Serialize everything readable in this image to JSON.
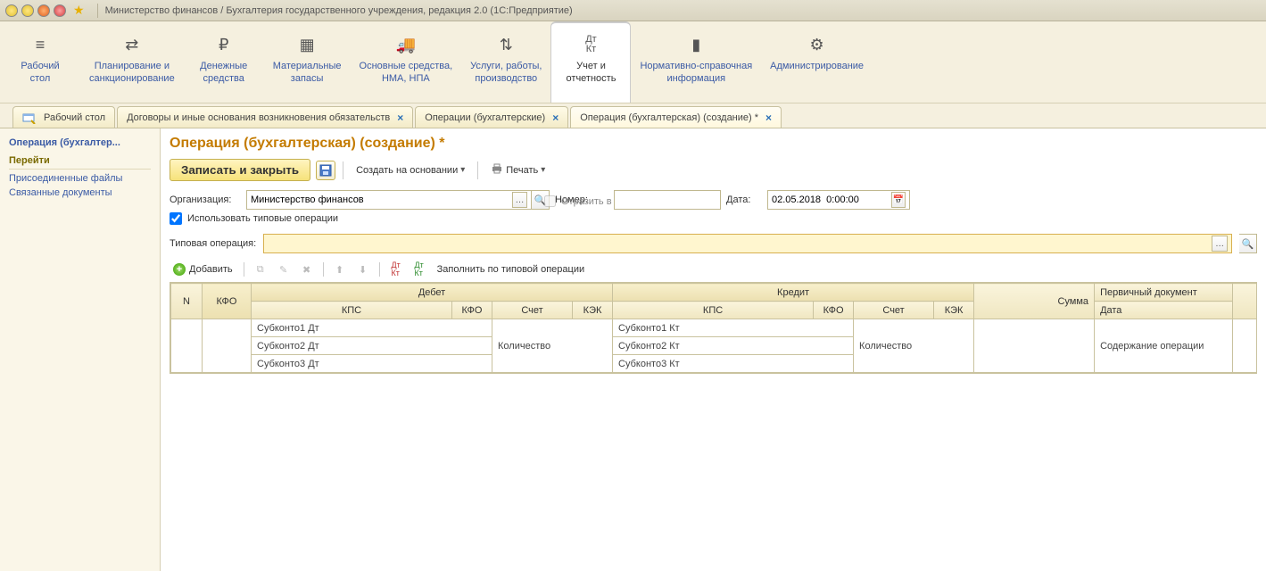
{
  "window": {
    "title": "Министерство финансов / Бухгалтерия государственного учреждения, редакция 2.0  (1С:Предприятие)"
  },
  "mainnav": [
    {
      "label": "Рабочий\nстол"
    },
    {
      "label": "Планирование и\nсанкционирование"
    },
    {
      "label": "Денежные\nсредства"
    },
    {
      "label": "Материальные\nзапасы"
    },
    {
      "label": "Основные средства,\nНМА, НПА"
    },
    {
      "label": "Услуги, работы,\nпроизводство"
    },
    {
      "label": "Учет и\nотчетность"
    },
    {
      "label": "Нормативно-справочная\nинформация"
    },
    {
      "label": "Администрирование"
    }
  ],
  "tabs": [
    {
      "label": "Рабочий стол",
      "closable": false,
      "with_icon": true
    },
    {
      "label": "Договоры и иные основания возникновения обязательств",
      "closable": true
    },
    {
      "label": "Операции (бухгалтерские)",
      "closable": true
    },
    {
      "label": "Операция (бухгалтерская) (создание) *",
      "closable": true,
      "active": true
    }
  ],
  "sidebar": {
    "title": "Операция (бухгалтер...",
    "heading": "Перейти",
    "links": [
      "Присоединенные файлы",
      "Связанные документы"
    ]
  },
  "page": {
    "title": "Операция (бухгалтерская) (создание) *",
    "btn_write_close": "Записать и закрыть",
    "btn_create_based": "Создать на основании",
    "btn_print": "Печать",
    "label_org": "Организация:",
    "org_value": "Министерство финансов",
    "label_number": "Номер:",
    "number_value": "",
    "label_date": "Дата:",
    "date_value": "02.05.2018  0:00:00",
    "reflect": "Отразить в межотчетном периоде",
    "use_typed": "Использовать типовые операции",
    "label_typed": "Типовая операция:",
    "typed_value": ""
  },
  "grid_tb": {
    "add": "Добавить",
    "fill": "Заполнить по типовой операции"
  },
  "grid": {
    "n": "N",
    "kfo": "КФО",
    "debit": "Дебет",
    "credit": "Кредит",
    "sum": "Сумма",
    "primary_doc": "Первичный документ",
    "kps": "КПС",
    "kfo2": "КФО",
    "account": "Счет",
    "kek": "КЭК",
    "date": "Дата",
    "n2": "Н",
    "subk1d": "Субконто1 Дт",
    "subk2d": "Субконто2 Дт",
    "subk3d": "Субконто3 Дт",
    "subk1k": "Субконто1 Кт",
    "subk2k": "Субконто2 Кт",
    "subk3k": "Субконто3 Кт",
    "qty": "Количество",
    "op_content": "Содержание операции"
  }
}
